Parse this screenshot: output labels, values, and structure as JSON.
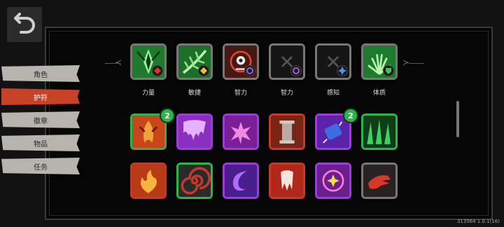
{
  "tabs": [
    {
      "label": "角色",
      "active": false
    },
    {
      "label": "护符",
      "active": true
    },
    {
      "label": "徽章",
      "active": false
    },
    {
      "label": "物品",
      "active": false
    },
    {
      "label": "任务",
      "active": false
    }
  ],
  "equipped_slots": [
    {
      "label": "力量",
      "icon": "green-crystal-leaf-icon",
      "frame": "gray",
      "gem": "red-gem-icon"
    },
    {
      "label": "敏捷",
      "icon": "green-vine-icon",
      "frame": "gray",
      "gem": "yellow-gem-icon"
    },
    {
      "label": "智力",
      "icon": "red-eye-sigil-icon",
      "frame": "gray",
      "gem": "purple-gem-icon"
    },
    {
      "label": "智力",
      "icon": "empty-slot-icon",
      "frame": "gray",
      "gem": "purple-gem-icon"
    },
    {
      "label": "感知",
      "icon": "empty-slot-icon",
      "frame": "gray",
      "gem": "blue-gem-icon"
    },
    {
      "label": "体质",
      "icon": "green-burst-icon",
      "frame": "gray",
      "gem": "green-gem-icon"
    }
  ],
  "inventory_row_1": [
    {
      "icon": "orange-flame-dragon-icon",
      "frame": "green",
      "count": "2"
    },
    {
      "icon": "purple-dripping-icon",
      "frame": "purple",
      "count": ""
    },
    {
      "icon": "pink-splash-icon",
      "frame": "purple",
      "count": ""
    },
    {
      "icon": "stone-pillar-icon",
      "frame": "red",
      "count": ""
    },
    {
      "icon": "blue-scroll-icon",
      "frame": "purple",
      "count": "2"
    },
    {
      "icon": "green-spikes-icon",
      "frame": "green",
      "count": ""
    }
  ],
  "inventory_row_2": [
    {
      "icon": "fire-burst-icon",
      "frame": "red",
      "count": ""
    },
    {
      "icon": "red-spiral-icon",
      "frame": "green",
      "count": ""
    },
    {
      "icon": "purple-swirl-icon",
      "frame": "purple",
      "count": ""
    },
    {
      "icon": "red-fang-icon",
      "frame": "red",
      "count": ""
    },
    {
      "icon": "pink-star-orb-icon",
      "frame": "purple",
      "count": ""
    },
    {
      "icon": "red-hand-icon",
      "frame": "gray",
      "count": ""
    }
  ],
  "version": "313564 1.0.1(16)"
}
